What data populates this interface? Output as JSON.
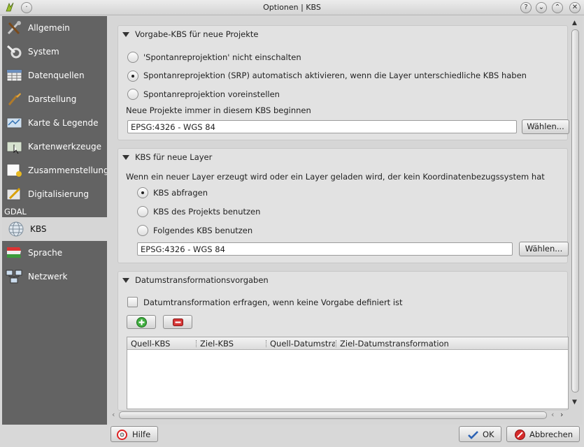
{
  "window": {
    "title": "Optionen | KBS",
    "controls": [
      "?",
      "⌄",
      "⌃",
      "✕"
    ]
  },
  "sidebar": {
    "items": [
      {
        "label": "Allgemein",
        "icon": "tools-icon"
      },
      {
        "label": "System",
        "icon": "wrench-gear-icon"
      },
      {
        "label": "Datenquellen",
        "icon": "table-icon"
      },
      {
        "label": "Darstellung",
        "icon": "brush-icon"
      },
      {
        "label": "Karte & Legende",
        "icon": "map-legend-icon"
      },
      {
        "label": "Kartenwerkzeuge",
        "icon": "map-cursor-icon"
      },
      {
        "label": "Zusammenstellung",
        "icon": "composer-icon"
      },
      {
        "label": "Digitalisierung",
        "icon": "digitize-icon"
      },
      {
        "label": "KBS",
        "icon": "globe-icon"
      },
      {
        "label": "Sprache",
        "icon": "language-flag-icon"
      },
      {
        "label": "Netzwerk",
        "icon": "network-icon"
      }
    ],
    "group_label": "GDAL"
  },
  "section_project": {
    "title": "Vorgabe-KBS für neue Projekte",
    "options": [
      {
        "label": "'Spontanreprojektion' nicht einschalten",
        "selected": false
      },
      {
        "label": "Spontanreprojektion (SRP) automatisch aktivieren, wenn die Layer unterschiedliche KBS haben",
        "selected": true
      },
      {
        "label": "Spontanreprojektion voreinstellen",
        "selected": false
      }
    ],
    "crs_label": "Neue Projekte immer in diesem KBS beginnen",
    "crs_value": "EPSG:4326 - WGS 84",
    "choose_button": "Wählen..."
  },
  "section_layer": {
    "title": "KBS für neue Layer",
    "description": "Wenn ein neuer Layer erzeugt wird oder ein Layer geladen wird, der kein Koordinatenbezugssystem hat",
    "options": [
      {
        "label": "KBS abfragen",
        "selected": true
      },
      {
        "label": "KBS des Projekts benutzen",
        "selected": false
      },
      {
        "label": "Folgendes KBS benutzen",
        "selected": false
      }
    ],
    "crs_value": "EPSG:4326 - WGS 84",
    "choose_button": "Wählen..."
  },
  "section_datum": {
    "title": "Datumstransformationsvorgaben",
    "ask_label": "Datumtransformation erfragen, wenn keine Vorgabe definiert ist",
    "ask_checked": false,
    "columns": [
      "Quell-KBS",
      "Ziel-KBS",
      "Quell-Datumstra",
      "Ziel-Datumstransformation"
    ],
    "rows": []
  },
  "footer": {
    "help": "Hilfe",
    "ok": "OK",
    "cancel": "Abbrechen"
  },
  "colors": {
    "sidebar_bg": "#636363",
    "selected_bg": "#d6d6d6",
    "window_bg": "#d8d8d8"
  }
}
